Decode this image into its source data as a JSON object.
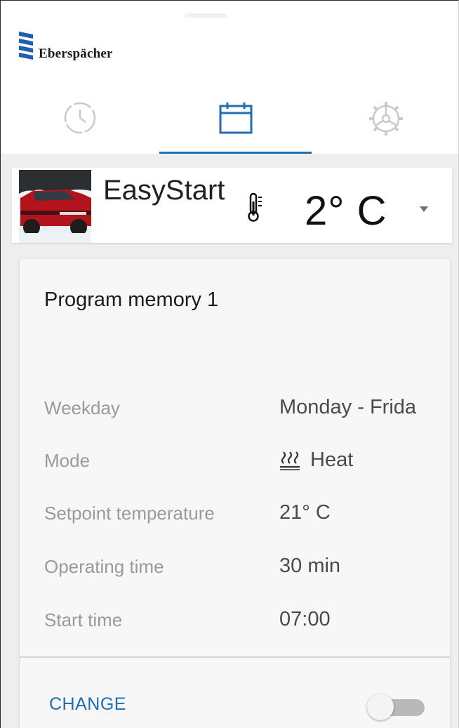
{
  "header": {
    "brand": "Eberspächer"
  },
  "tabs": [
    {
      "name": "timer",
      "icon": "clock-icon",
      "active": false
    },
    {
      "name": "schedule",
      "icon": "calendar-icon",
      "active": true
    },
    {
      "name": "settings",
      "icon": "gear-icon",
      "active": false
    }
  ],
  "heater": {
    "name": "EasyStart",
    "temperature": "2° C",
    "thermometer_icon": "thermometer-icon",
    "dropdown_icon": "dropdown-arrow-icon"
  },
  "program": {
    "title": "Program memory 1",
    "rows": [
      {
        "label": "Weekday",
        "value": "Monday - Frida"
      },
      {
        "label": "Mode",
        "value": "Heat",
        "icon": "heat-icon"
      },
      {
        "label": "Setpoint temperature",
        "value": "21° C"
      },
      {
        "label": "Operating time",
        "value": "30 min"
      },
      {
        "label": "Start time",
        "value": "07:00"
      }
    ],
    "change_label": "CHANGE",
    "enabled": false
  },
  "colors": {
    "accent": "#1f6db3",
    "background": "#eeeeee",
    "card": "#f7f7f7",
    "label": "#9a9a9a"
  }
}
